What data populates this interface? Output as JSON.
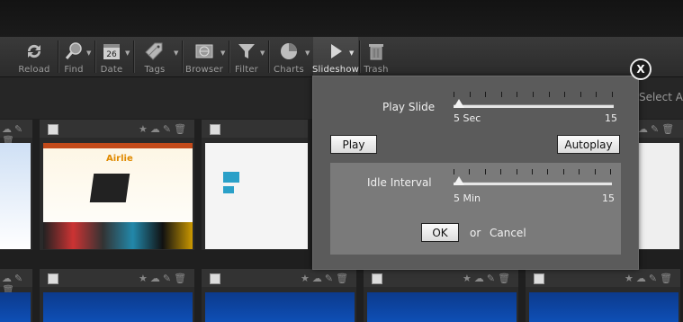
{
  "toolbar": {
    "items": [
      {
        "label": "Reload",
        "icon": "reload-icon"
      },
      {
        "label": "Find",
        "icon": "find-icon"
      },
      {
        "label": "Date",
        "icon": "calendar-icon",
        "badge": "26"
      },
      {
        "label": "Tags",
        "icon": "tags-icon"
      },
      {
        "label": "Browser",
        "icon": "browser-icon"
      },
      {
        "label": "Filter",
        "icon": "filter-icon"
      },
      {
        "label": "Charts",
        "icon": "pie-chart-icon"
      },
      {
        "label": "Slideshow",
        "icon": "play-icon"
      },
      {
        "label": "Trash",
        "icon": "trash-icon"
      }
    ]
  },
  "subbar": {
    "select_all": "Select A"
  },
  "thumb_logo": {
    "site_name": "Airlie"
  },
  "dialog": {
    "close_label": "X",
    "play_slide": {
      "label": "Play Slide",
      "min_label": "5 Sec",
      "max_label": "15",
      "value_fraction": 0.0
    },
    "play_button": "Play",
    "autoplay_button": "Autoplay",
    "idle_interval": {
      "label": "Idle Interval",
      "min_label": "5 Min",
      "max_label": "15",
      "value_fraction": 0.0
    },
    "ok_button": "OK",
    "or_text": "or",
    "cancel_link": "Cancel"
  },
  "colors": {
    "accent": "#f2f2f2",
    "dialog_bg": "#5b5b5b",
    "idle_bg": "#7a7a7a"
  }
}
